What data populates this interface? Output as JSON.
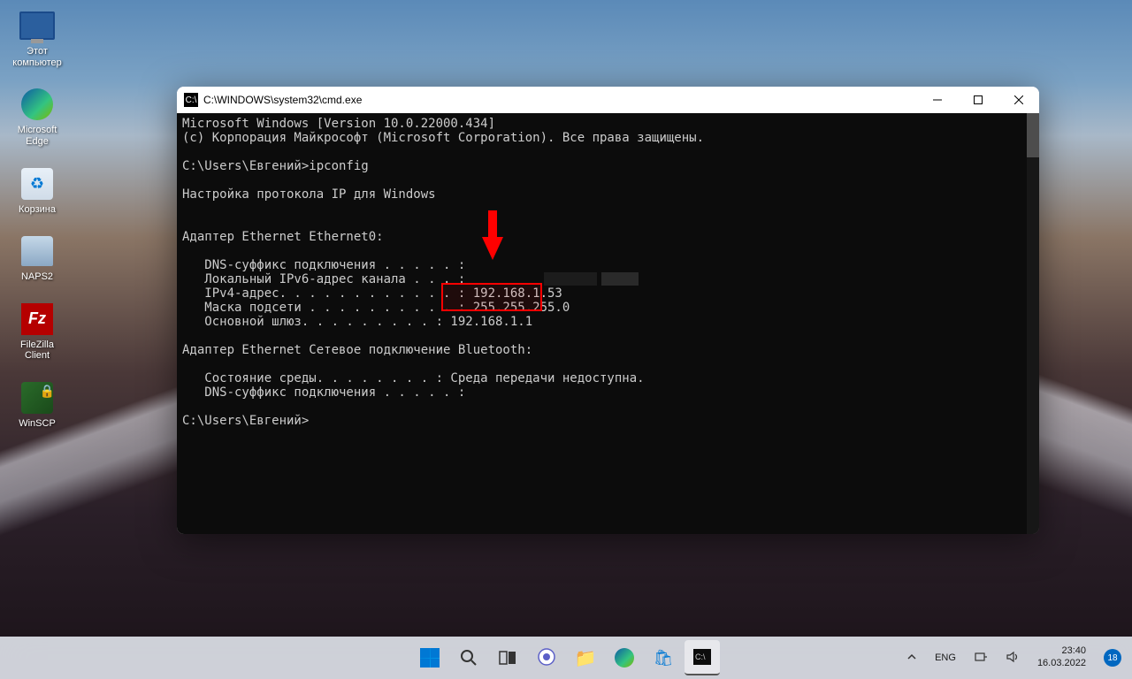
{
  "desktop": {
    "icons": [
      {
        "name": "this-pc",
        "label": "Этот\nкомпьютер"
      },
      {
        "name": "edge",
        "label": "Microsoft\nEdge"
      },
      {
        "name": "recycle-bin",
        "label": "Корзина"
      },
      {
        "name": "naps2",
        "label": "NAPS2"
      },
      {
        "name": "filezilla",
        "label": "FileZilla\nClient"
      },
      {
        "name": "winscp",
        "label": "WinSCP"
      }
    ]
  },
  "cmd": {
    "title": "C:\\WINDOWS\\system32\\cmd.exe",
    "lines": {
      "l1": "Microsoft Windows [Version 10.0.22000.434]",
      "l2": "(c) Корпорация Майкрософт (Microsoft Corporation). Все права защищены.",
      "l3": "",
      "l4": "C:\\Users\\Евгений>ipconfig",
      "l5": "",
      "l6": "Настройка протокола IP для Windows",
      "l7": "",
      "l8": "",
      "l9": "Адаптер Ethernet Ethernet0:",
      "l10": "",
      "l11": "   DNS-суффикс подключения . . . . . :",
      "l12": "   Локальный IPv6-адрес канала . . . :",
      "l13": "   IPv4-адрес. . . . . . . . . . . . : 192.168.1.53",
      "l14": "   Маска подсети . . . . . . . . . . : 255.255.255.0",
      "l15": "   Основной шлюз. . . . . . . . . : 192.168.1.1",
      "l16": "",
      "l17": "Адаптер Ethernet Сетевое подключение Bluetooth:",
      "l18": "",
      "l19": "   Состояние среды. . . . . . . . : Среда передачи недоступна.",
      "l20": "   DNS-суффикс подключения . . . . . :",
      "l21": "",
      "l22": "C:\\Users\\Евгений>"
    },
    "highlight_ip": "192.168.1.53"
  },
  "taskbar": {
    "lang": "ENG",
    "time": "23:40",
    "date": "16.03.2022",
    "notif_count": "18"
  }
}
